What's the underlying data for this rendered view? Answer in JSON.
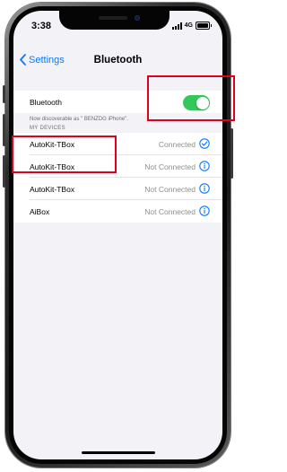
{
  "status_bar": {
    "time": "3:38",
    "network": "4G"
  },
  "nav": {
    "back_label": "Settings",
    "title": "Bluetooth"
  },
  "bluetooth": {
    "label": "Bluetooth",
    "enabled": true,
    "discoverable_text": "Now discoverable as \" BENZDG iPhone\"."
  },
  "devices_header": "MY DEVICES",
  "devices": [
    {
      "name": "AutoKit-TBox",
      "status": "Connected",
      "icon": "checkmark-circle-icon"
    },
    {
      "name": "AutoKit-TBox",
      "status": "Not Connected",
      "icon": "info-icon"
    },
    {
      "name": "AutoKit-TBox",
      "status": "Not Connected",
      "icon": "info-icon"
    },
    {
      "name": "AiBox",
      "status": "Not Connected",
      "icon": "info-icon"
    }
  ],
  "colors": {
    "accent": "#0a7aff",
    "toggle_on": "#34c759",
    "highlight": "#e0001b",
    "background": "#f2f2f7"
  }
}
